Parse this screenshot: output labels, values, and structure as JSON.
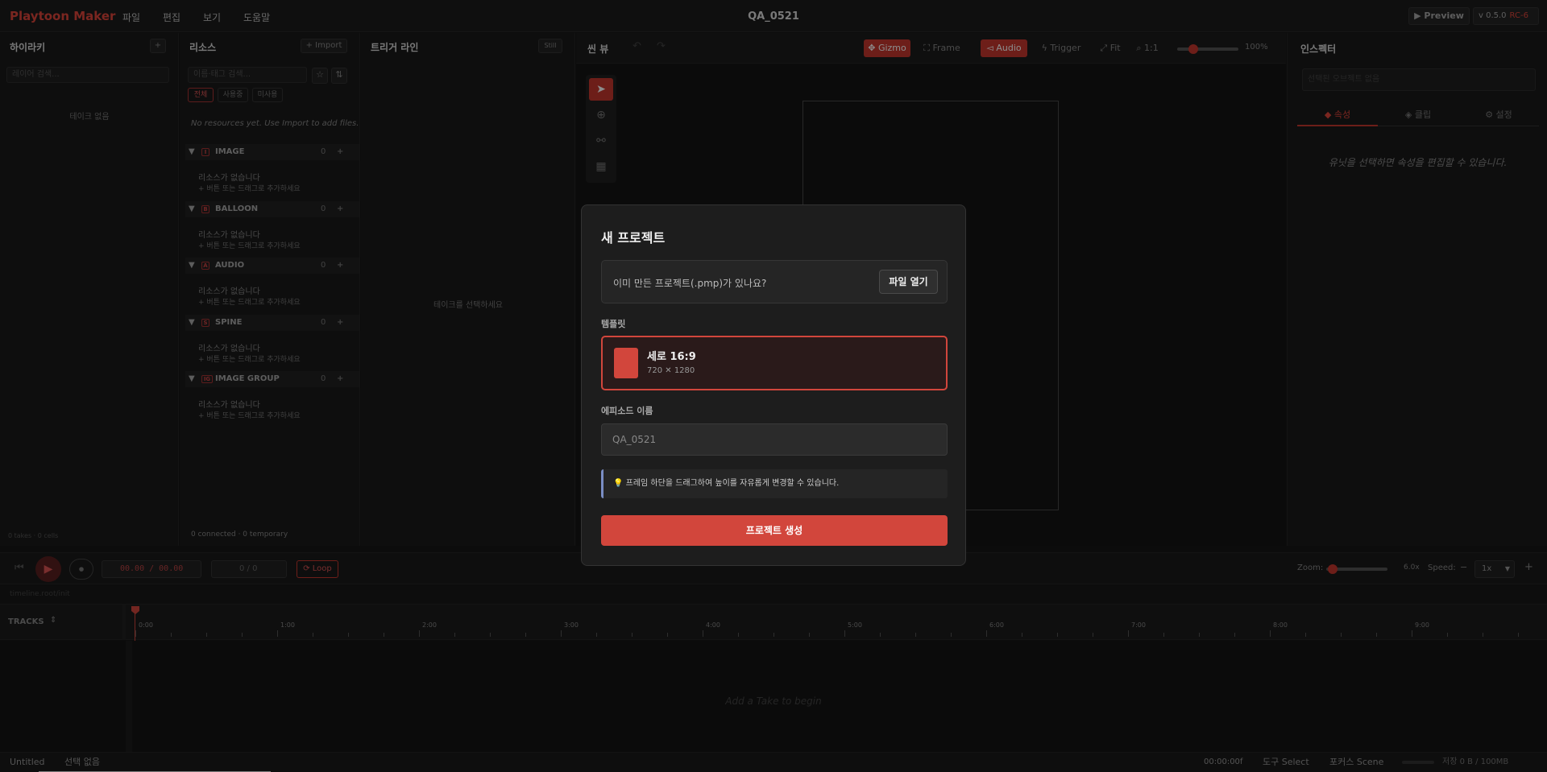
{
  "app": {
    "logo": "Playtoon Maker",
    "title": "QA_0521",
    "preview": "▶ Preview",
    "version": "v 0.5.0",
    "rc": "RC-6"
  },
  "menu": [
    "파일",
    "편집",
    "보기",
    "도움말"
  ],
  "hierarchy": {
    "title": "하이라키",
    "add": "+",
    "search_placeholder": "레이어 검색...",
    "empty": "테이크 없음",
    "footer": "0 takes · 0 cells"
  },
  "resources": {
    "title": "리소스",
    "import": "+ Import",
    "search_placeholder": "이름·태그 검색...",
    "filters": [
      "전체",
      "사용중",
      "미사용"
    ],
    "no_resources": "No resources yet. Use Import to add files.",
    "categories": [
      {
        "icon": "I",
        "name": "IMAGE",
        "count": "0"
      },
      {
        "icon": "B",
        "name": "BALLOON",
        "count": "0"
      },
      {
        "icon": "A",
        "name": "AUDIO",
        "count": "0"
      },
      {
        "icon": "S",
        "name": "SPINE",
        "count": "0"
      },
      {
        "icon": "IG",
        "name": "IMAGE GROUP",
        "count": "0"
      }
    ],
    "empty_line1": "리소스가 없습니다",
    "empty_line2": "+ 버튼 또는 드래그로 추가하세요",
    "footer": "0 connected · 0 temporary"
  },
  "trigger": {
    "title": "트리거 라인",
    "btn": "Still",
    "empty": "테이크를 선택하세요"
  },
  "sceneview": {
    "title": "씬 뷰",
    "gizmo": "Gizmo",
    "frame": "Frame",
    "audio": "Audio",
    "trigger": "Trigger",
    "fit": "Fit",
    "one": "1:1",
    "zoom": "100%"
  },
  "inspector": {
    "title": "인스펙터",
    "search_placeholder": "선택된 오브젝트 없음",
    "tabs": [
      "속성",
      "클립",
      "설정"
    ],
    "empty": "유닛을 선택하면 속성을 편집할 수 있습니다."
  },
  "transport": {
    "time": "00.00 / 00.00",
    "frames": "0 / 0",
    "loop": "⟳ Loop",
    "zoom_label": "Zoom:",
    "zoom_val": "6.0x",
    "speed_label": "Speed:",
    "speed_minus": "−",
    "speed_val": "1x",
    "speed_plus": "+"
  },
  "timeline": {
    "path": "timeline.root/init",
    "tracks": "TRACKS",
    "ticks": [
      "0:00",
      "1:00",
      "2:00",
      "3:00",
      "4:00",
      "5:00",
      "6:00",
      "7:00",
      "8:00",
      "9:00"
    ],
    "empty": "Add a Take to begin"
  },
  "status": {
    "file": "Untitled",
    "selection": "선택 없음",
    "time": "00:00:00f",
    "tool": "도구 Select",
    "focus": "포커스 Scene",
    "memory": "저장 0 B / 100MB"
  },
  "modal": {
    "title": "새 프로젝트",
    "open_question": "이미 만든 프로젝트(.pmp)가 있나요?",
    "open_button": "파일 열기",
    "template_label": "템플릿",
    "template_name": "세로 16:9",
    "template_size": "720 ✕ 1280",
    "episode_label": "에피소드 이름",
    "episode_value": "QA_0521",
    "tip": "프레임 하단을 드래그하여 높이를 자유롭게 변경할 수 있습니다.",
    "create_button": "프로젝트 생성"
  }
}
